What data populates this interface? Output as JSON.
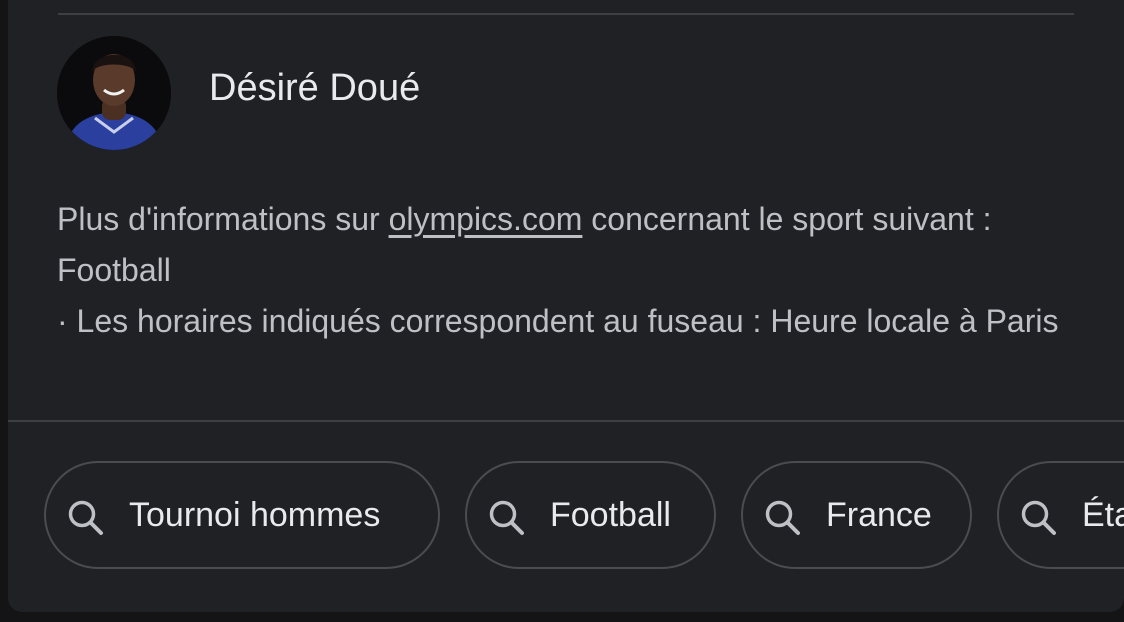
{
  "player": {
    "name": "Désiré Doué"
  },
  "info": {
    "prefix": "Plus d'informations sur ",
    "link_text": "olympics.com",
    "suffix": " concernant le sport suivant : Football",
    "note": "· Les horaires indiqués correspondent au fuseau : Heure locale à Paris"
  },
  "chips": [
    {
      "label": "Tournoi hommes",
      "icon": "search-icon"
    },
    {
      "label": "Football",
      "icon": "search-icon"
    },
    {
      "label": "France",
      "icon": "search-icon"
    },
    {
      "label": "Éta",
      "icon": "search-icon"
    }
  ]
}
